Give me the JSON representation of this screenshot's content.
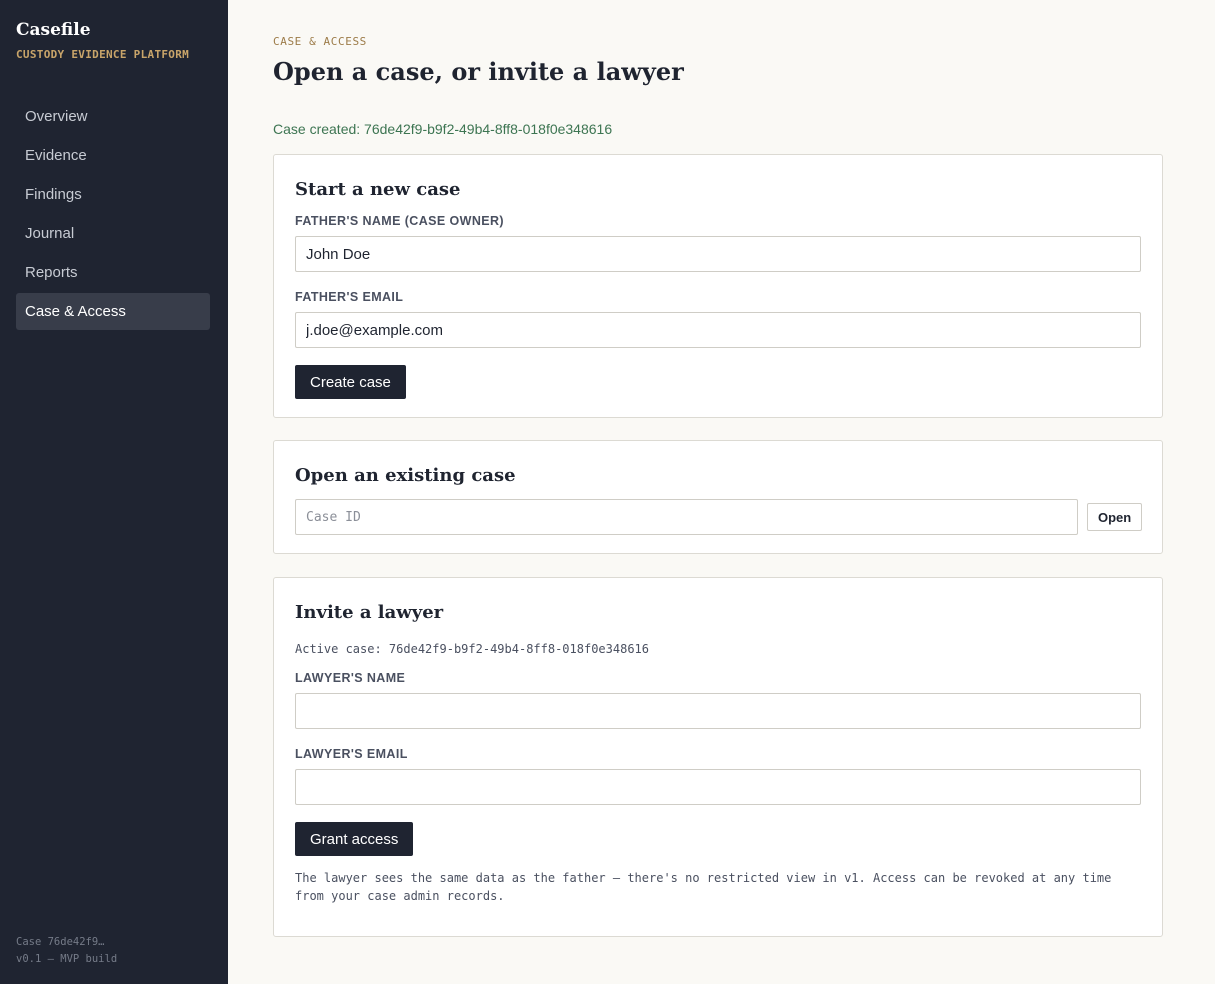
{
  "sidebar": {
    "app_title": "Casefile",
    "app_subtitle": "CUSTODY EVIDENCE PLATFORM",
    "items": [
      {
        "label": "Overview"
      },
      {
        "label": "Evidence"
      },
      {
        "label": "Findings"
      },
      {
        "label": "Journal"
      },
      {
        "label": "Reports"
      },
      {
        "label": "Case & Access",
        "active": true
      }
    ],
    "footer_case": "Case 76de42f9…",
    "footer_version": "v0.1 — MVP build"
  },
  "header": {
    "eyebrow": "CASE & ACCESS",
    "title": "Open a case, or invite a lawyer"
  },
  "status_message": "Case created: 76de42f9-b9f2-49b4-8ff8-018f0e348616",
  "new_case": {
    "title": "Start a new case",
    "name_label": "FATHER'S NAME (CASE OWNER)",
    "name_value": "John Doe",
    "email_label": "FATHER'S EMAIL",
    "email_value": "j.doe@example.com",
    "create_label": "Create case"
  },
  "existing_case": {
    "title": "Open an existing case",
    "case_id_placeholder": "Case ID",
    "case_id_value": "",
    "open_label": "Open"
  },
  "invite": {
    "title": "Invite a lawyer",
    "active_case": "Active case: 76de42f9-b9f2-49b4-8ff8-018f0e348616",
    "name_label": "LAWYER'S NAME",
    "name_value": "",
    "email_label": "LAWYER'S EMAIL",
    "email_value": "",
    "grant_label": "Grant access",
    "note": "The lawyer sees the same data as the father — there's no restricted view in v1. Access can be revoked at any time from your case admin records."
  },
  "colors": {
    "sidebar_bg": "#1f2431",
    "accent": "#c9a56a",
    "success_text": "#3d7552",
    "primary_button": "#1f2431"
  }
}
